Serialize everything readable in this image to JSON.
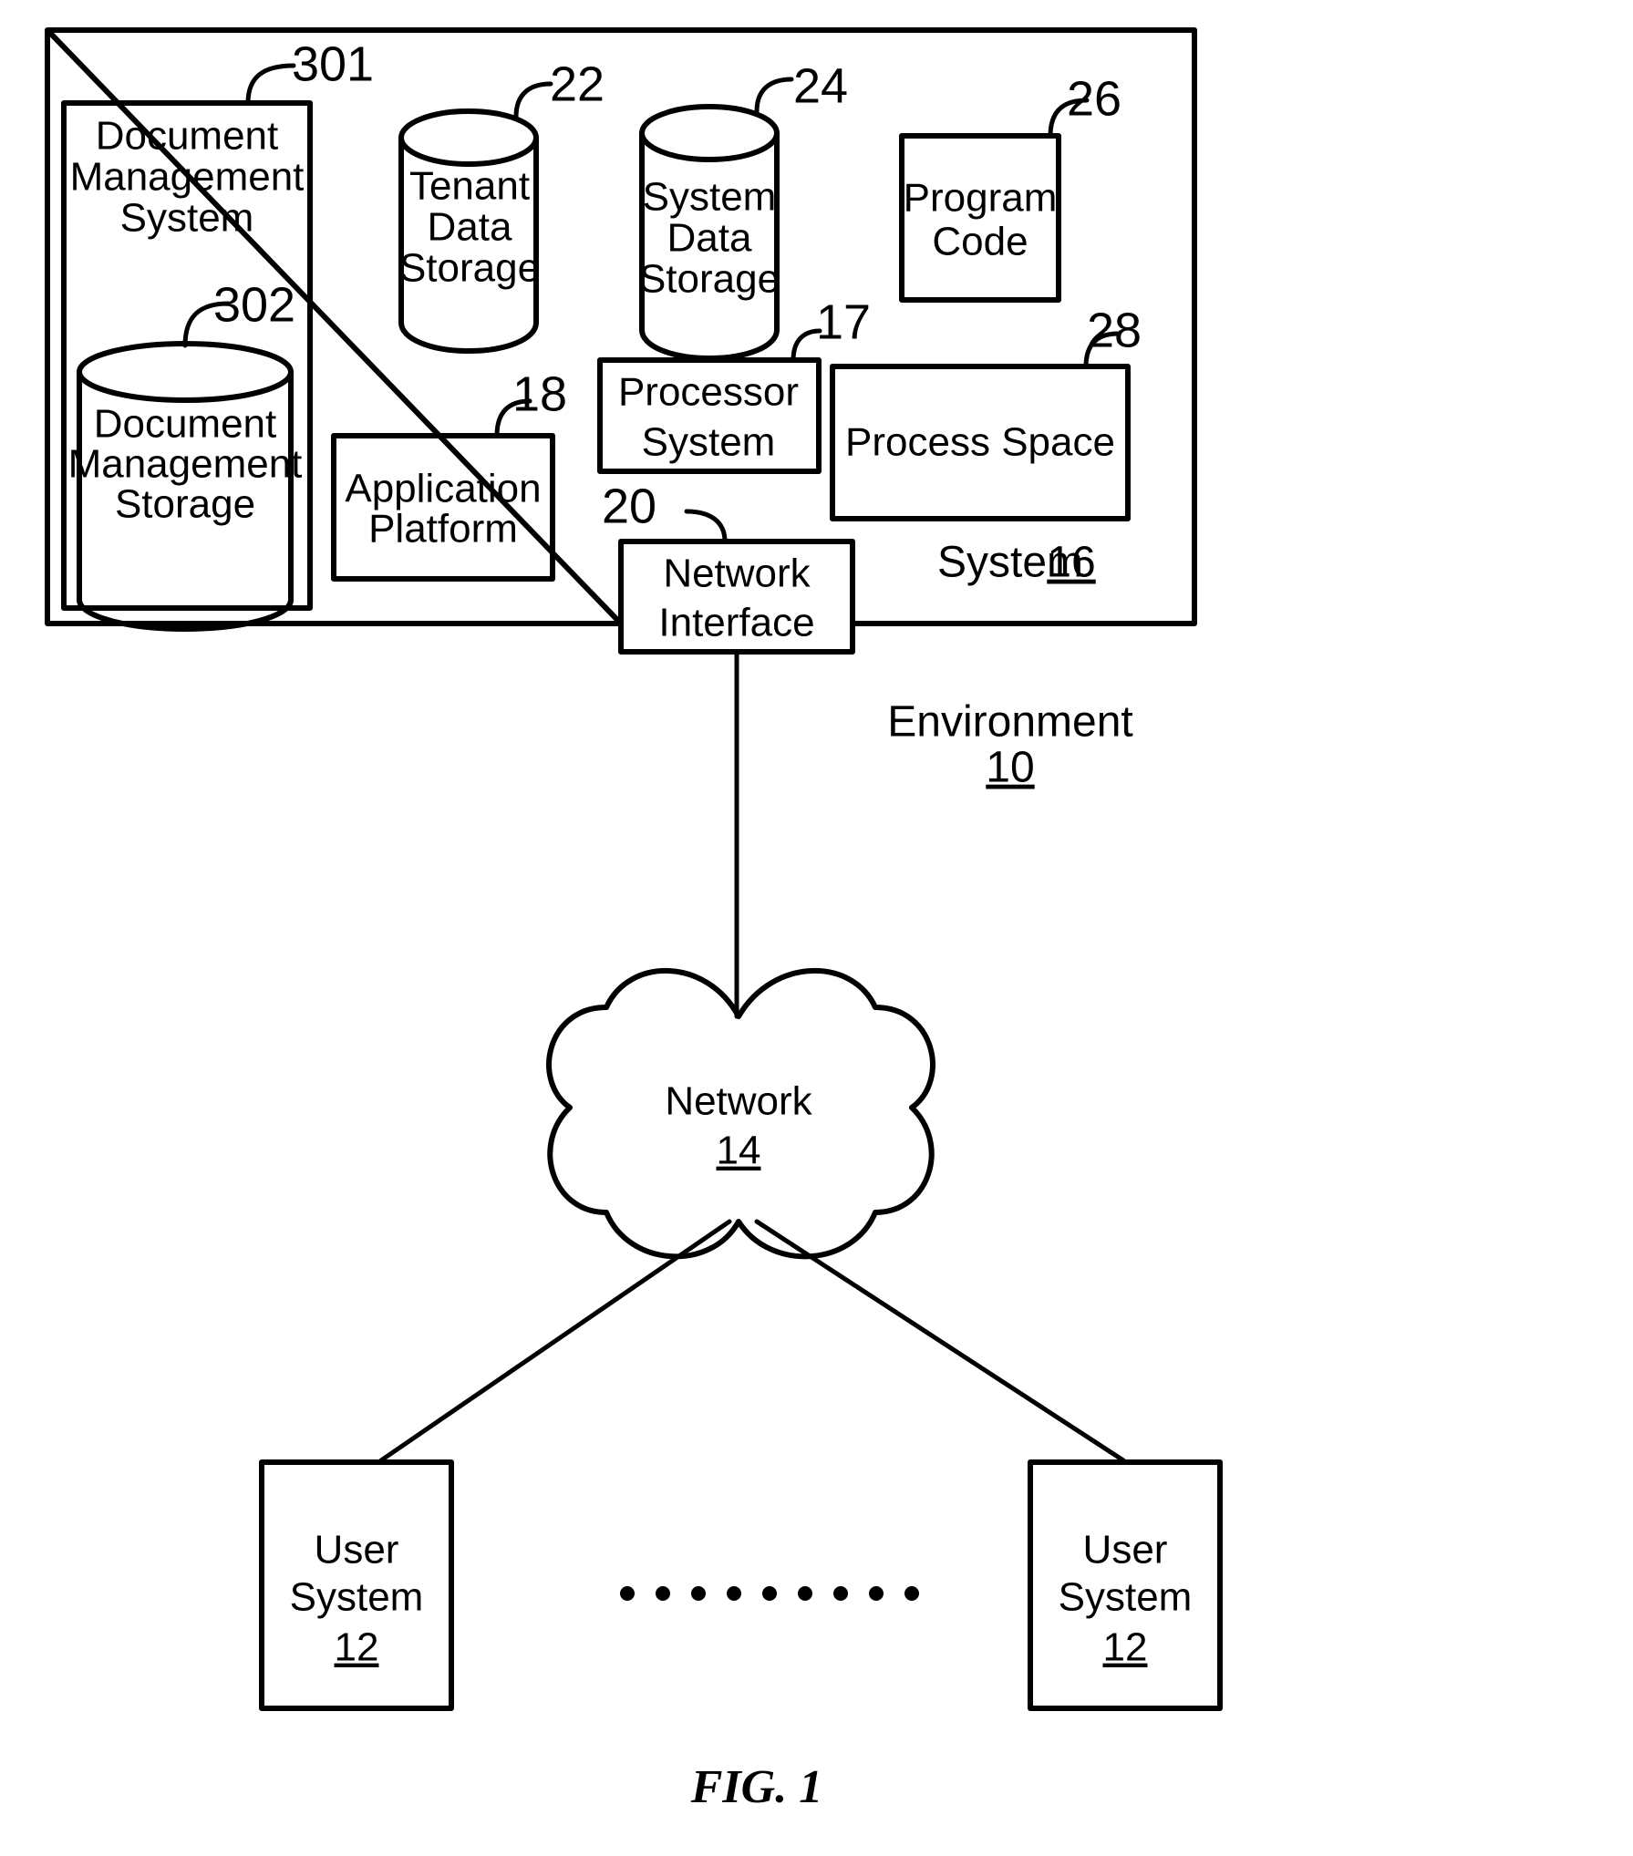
{
  "figure": {
    "caption": "FIG. 1",
    "environment_label": "Environment",
    "environment_ref": "10",
    "system_label": "System",
    "system_ref": "16"
  },
  "blocks": {
    "document_management_system": {
      "label_line1": "Document",
      "label_line2": "Management",
      "label_line3": "System",
      "ref": "301"
    },
    "document_management_storage": {
      "label_line1": "Document",
      "label_line2": "Management",
      "label_line3": "Storage",
      "ref": "302"
    },
    "tenant_data_storage": {
      "label_line1": "Tenant",
      "label_line2": "Data",
      "label_line3": "Storage",
      "ref": "22"
    },
    "system_data_storage": {
      "label_line1": "System",
      "label_line2": "Data",
      "label_line3": "Storage",
      "ref": "24"
    },
    "program_code": {
      "label_line1": "Program",
      "label_line2": "Code",
      "ref": "26"
    },
    "process_space": {
      "label_line1": "Process Space",
      "ref": "28"
    },
    "processor_system": {
      "label_line1": "Processor",
      "label_line2": "System",
      "ref": "17"
    },
    "application_platform": {
      "label_line1": "Application",
      "label_line2": "Platform",
      "ref": "18"
    },
    "network_interface": {
      "label_line1": "Network",
      "label_line2": "Interface",
      "ref": "20"
    },
    "network_cloud": {
      "label_line1": "Network",
      "ref": "14"
    },
    "user_system_left": {
      "label_line1": "User",
      "label_line2": "System",
      "ref": "12"
    },
    "user_system_right": {
      "label_line1": "User",
      "label_line2": "System",
      "ref": "12"
    }
  },
  "ellipsis": {
    "dot_count": 9
  }
}
